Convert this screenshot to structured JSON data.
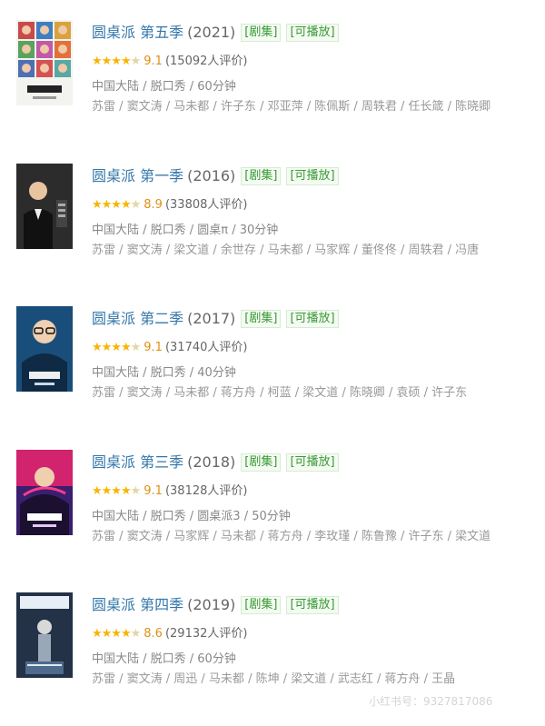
{
  "items": [
    {
      "title": "圆桌派 第五季",
      "year": "(2021)",
      "tag_series": "[剧集]",
      "tag_playable": "[可播放]",
      "stars": "★★★★",
      "half_star": "★",
      "score": "9.1",
      "count": "(15092人评价)",
      "meta": "中国大陆 / 脱口秀 / 60分钟",
      "cast": "苏雷 / 窦文涛 / 马未都 / 许子东 / 邓亚萍 / 陈佩斯 / 周轶君 / 任长箴 / 陈晓卿"
    },
    {
      "title": "圆桌派 第一季",
      "year": "(2016)",
      "tag_series": "[剧集]",
      "tag_playable": "[可播放]",
      "stars": "★★★★",
      "half_star": "★",
      "score": "8.9",
      "count": "(33808人评价)",
      "meta": "中国大陆 / 脱口秀 / 圆桌π / 30分钟",
      "cast": "苏雷 / 窦文涛 / 梁文道 / 余世存 / 马未都 / 马家辉 / 董佟佟 / 周轶君 / 冯唐"
    },
    {
      "title": "圆桌派 第二季",
      "year": "(2017)",
      "tag_series": "[剧集]",
      "tag_playable": "[可播放]",
      "stars": "★★★★",
      "half_star": "★",
      "score": "9.1",
      "count": "(31740人评价)",
      "meta": "中国大陆 / 脱口秀 / 40分钟",
      "cast": "苏雷 / 窦文涛 / 马未都 / 蒋方舟 / 柯蓝 / 梁文道 / 陈晓卿 / 袁硕 / 许子东"
    },
    {
      "title": "圆桌派 第三季",
      "year": "(2018)",
      "tag_series": "[剧集]",
      "tag_playable": "[可播放]",
      "stars": "★★★★",
      "half_star": "★",
      "score": "9.1",
      "count": "(38128人评价)",
      "meta": "中国大陆 / 脱口秀 / 圆桌派3 / 50分钟",
      "cast": "苏雷 / 窦文涛 / 马家辉 / 马未都 / 蒋方舟 / 李玫瑾 / 陈鲁豫 / 许子东 / 梁文道"
    },
    {
      "title": "圆桌派 第四季",
      "year": "(2019)",
      "tag_series": "[剧集]",
      "tag_playable": "[可播放]",
      "stars": "★★★★",
      "half_star": "★",
      "score": "8.6",
      "count": "(29132人评价)",
      "meta": "中国大陆 / 脱口秀 / 60分钟",
      "cast": "苏雷 / 窦文涛 / 周迅 / 马未都 / 陈坤 / 梁文道 / 武志红 / 蒋方舟 / 王晶"
    }
  ],
  "watermark": "小红书号：9327817086",
  "colors": {
    "link": "#3377aa",
    "tag_green": "#3a9a36",
    "star": "#f7b500",
    "meta_gray": "#888888"
  }
}
